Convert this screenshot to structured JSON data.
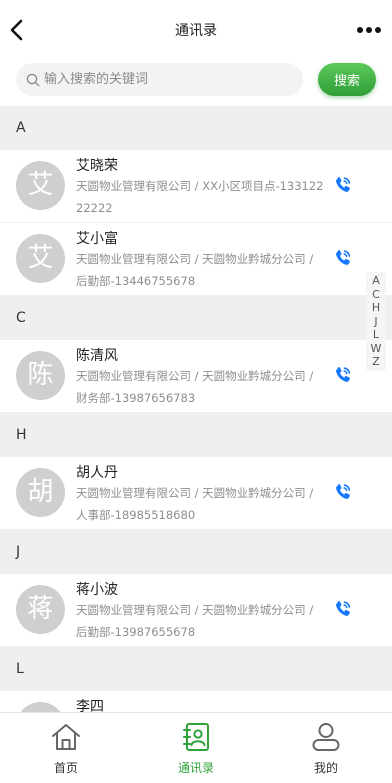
{
  "header": {
    "title": "通讯录"
  },
  "search": {
    "placeholder": "输入搜索的关键词",
    "button_label": "搜索"
  },
  "sections": [
    {
      "letter": "A",
      "contacts": [
        {
          "avatar": "艾",
          "name": "艾晓荣",
          "desc": "天圆物业管理有限公司 / XX小区项目点-13312222222"
        },
        {
          "avatar": "艾",
          "name": "艾小富",
          "desc": "天圆物业管理有限公司 / 天圆物业黔城分公司 / 后勤部-13446755678"
        }
      ]
    },
    {
      "letter": "C",
      "contacts": [
        {
          "avatar": "陈",
          "name": "陈清风",
          "desc": "天圆物业管理有限公司 / 天圆物业黔城分公司 / 财务部-13987656783"
        }
      ]
    },
    {
      "letter": "H",
      "contacts": [
        {
          "avatar": "胡",
          "name": "胡人丹",
          "desc": "天圆物业管理有限公司 / 天圆物业黔城分公司 / 人事部-18985518680"
        }
      ]
    },
    {
      "letter": "J",
      "contacts": [
        {
          "avatar": "蒋",
          "name": "蒋小波",
          "desc": "天圆物业管理有限公司 / 天圆物业黔城分公司 / 后勤部-13987655678"
        }
      ]
    },
    {
      "letter": "L",
      "contacts": [
        {
          "avatar": "李",
          "name": "李四",
          "desc": ""
        }
      ]
    }
  ],
  "alpha_index": [
    "A",
    "C",
    "H",
    "J",
    "L",
    "W",
    "Z"
  ],
  "tabs": [
    {
      "label": "首页",
      "icon": "home-icon"
    },
    {
      "label": "通讯录",
      "icon": "contacts-icon",
      "active": true
    },
    {
      "label": "我的",
      "icon": "profile-icon"
    }
  ],
  "colors": {
    "accent": "#2ea33a",
    "phone": "#1677ff",
    "avatar_bg": "#cfcfcf"
  }
}
